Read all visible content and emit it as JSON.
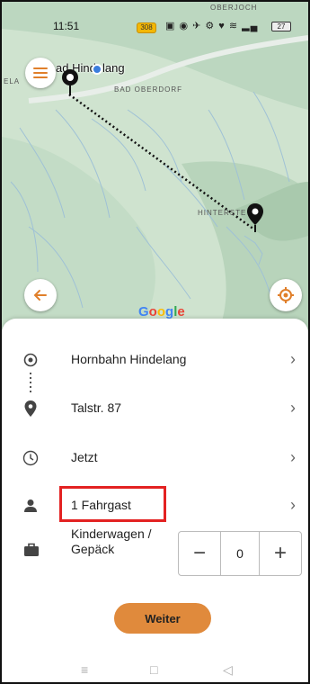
{
  "status_bar": {
    "time": "11:51",
    "road_number": "308",
    "battery": "27"
  },
  "map": {
    "labels": {
      "top": "OBERJOCH",
      "left_edge": "ELA",
      "town": "ad Hindelang",
      "bad_oberdorf": "BAD OBERDORF",
      "hinterstein": "HINTERSTE"
    },
    "google": [
      "G",
      "o",
      "o",
      "g",
      "l",
      "e"
    ],
    "colors": {
      "terrain": "#cfe3cf",
      "rivers": "#9fc1d6",
      "route": "#111111",
      "accent": "#e07f2a"
    }
  },
  "sheet": {
    "rows": [
      {
        "label": "Hornbahn Hindelang",
        "icon": "target-icon"
      },
      {
        "label": "Talstr. 87",
        "icon": "location-pin-icon"
      },
      {
        "label": "Jetzt",
        "icon": "clock-icon"
      },
      {
        "label": "1 Fahrgast",
        "icon": "person-icon"
      }
    ],
    "luggage": {
      "label": "Kinderwagen / Gepäck",
      "value": "0",
      "minus": "−",
      "plus": "+"
    },
    "weiter_label": "Weiter",
    "chevron": "›"
  },
  "nav": {
    "menu": "≡",
    "home": "□",
    "back": "◁"
  }
}
